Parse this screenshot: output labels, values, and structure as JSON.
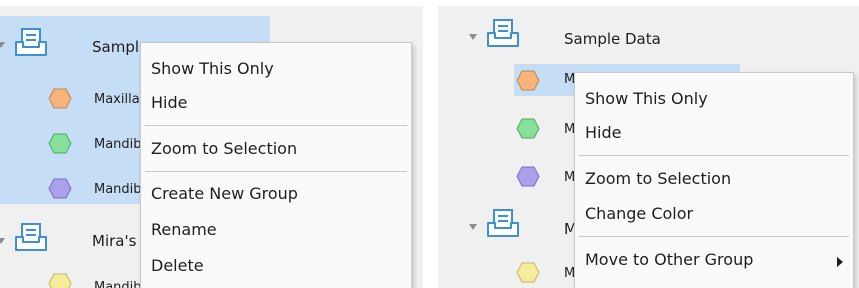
{
  "left": {
    "tree": [
      {
        "kind": "group",
        "label": "Sampl"
      },
      {
        "kind": "item",
        "label": "Maxilla",
        "color": "#f6b47a"
      },
      {
        "kind": "item",
        "label": "Mandib",
        "color": "#86e09a"
      },
      {
        "kind": "item",
        "label": "Mandib",
        "color": "#aaa0ec"
      },
      {
        "kind": "group",
        "label": "Mira's"
      },
      {
        "kind": "item",
        "label": "Mandib",
        "color": "#f6ec9a"
      }
    ],
    "menu": [
      "Show This Only",
      "Hide",
      "Zoom to Selection",
      "Create New Group",
      "Rename",
      "Delete"
    ]
  },
  "right": {
    "tree": [
      {
        "kind": "group",
        "label": "Sample Data"
      },
      {
        "kind": "item",
        "label": "M",
        "color": "#f6b47a"
      },
      {
        "kind": "item",
        "label": "M",
        "color": "#86e09a"
      },
      {
        "kind": "item",
        "label": "M",
        "color": "#aaa0ec"
      },
      {
        "kind": "group",
        "label": "M"
      },
      {
        "kind": "item",
        "label": "M",
        "color": "#f6ec9a"
      }
    ],
    "menu": [
      "Show This Only",
      "Hide",
      "Zoom to Selection",
      "Change Color",
      "Move to Other Group"
    ]
  },
  "icons": {
    "group": "tray-icon",
    "item": "hexagon-icon",
    "expand": "triangle-down-icon",
    "submenu": "triangle-right-icon"
  }
}
